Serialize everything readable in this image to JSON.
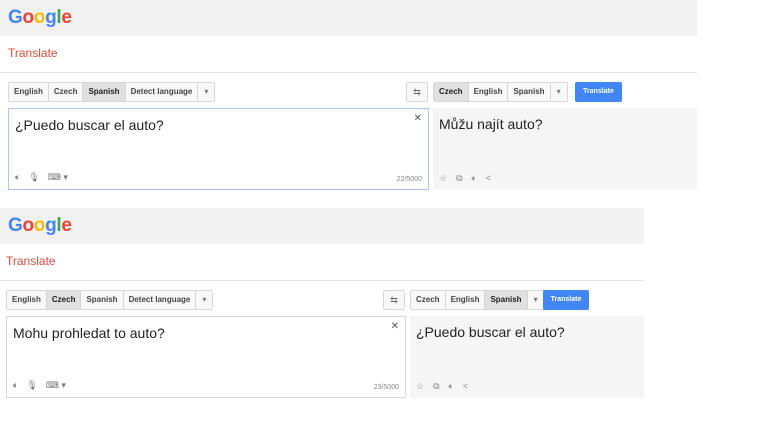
{
  "panels": [
    {
      "logo": "Google",
      "title": "Translate",
      "source_langs": [
        "English",
        "Czech",
        "Spanish",
        "Detect language"
      ],
      "source_active": 2,
      "target_langs": [
        "Czech",
        "English",
        "Spanish"
      ],
      "target_active": 0,
      "translate_button": "Translate",
      "source_text": "¿Puedo buscar el auto?",
      "char_count": "22/5000",
      "output_text": "Můžu najít auto?"
    },
    {
      "logo": "Google",
      "title": "Translate",
      "source_langs": [
        "English",
        "Czech",
        "Spanish",
        "Detect language"
      ],
      "source_active": 1,
      "target_langs": [
        "Czech",
        "English",
        "Spanish"
      ],
      "target_active": 2,
      "translate_button": "Translate",
      "source_text": "Mohu prohledat to auto?",
      "char_count": "23/5000",
      "output_text": "¿Puedo buscar el auto?"
    }
  ],
  "icons": {
    "dropdown": "chevron-down-icon",
    "swap": "swap-icon",
    "close": "close-icon",
    "speaker": "speaker-icon",
    "mic": "microphone-icon",
    "keyboard": "keyboard-icon",
    "star": "star-icon",
    "copy": "copy-icon",
    "share": "share-icon"
  },
  "colors": {
    "brand_red": "#dd4b39",
    "translate_blue": "#4285f4",
    "logo_blue": "#4285f4",
    "logo_red": "#ea4335",
    "logo_yellow": "#fbbc05",
    "logo_green": "#34a853"
  }
}
